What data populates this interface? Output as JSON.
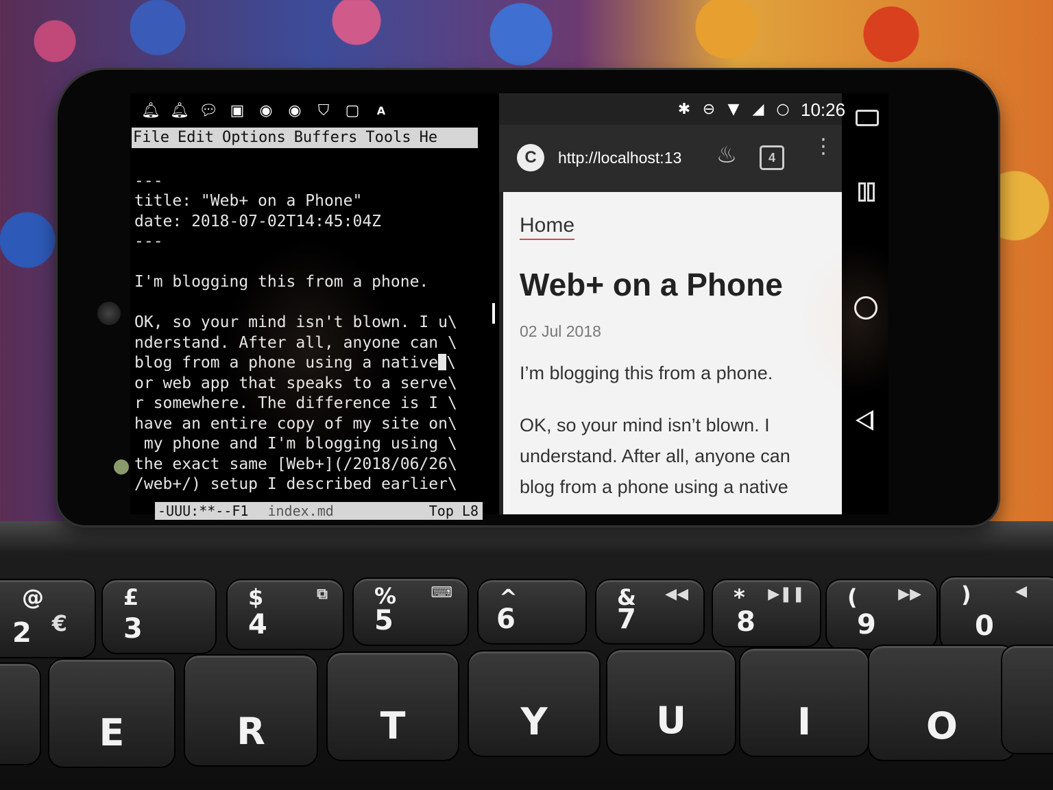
{
  "status_bar": {
    "left_icons": [
      "notification-3-icon",
      "bell-icon",
      "chat-bubble-icon",
      "image-icon",
      "record-icon",
      "record-icon-2",
      "shield-icon",
      "terminal-icon",
      "keyboard-a-icon"
    ],
    "right_icons": [
      "bluetooth-icon",
      "do-not-disturb-icon",
      "wifi-icon",
      "signal-icon",
      "loading-ring-icon"
    ],
    "time": "10:26"
  },
  "emacs": {
    "menu": [
      "File",
      "Edit",
      "Options",
      "Buffers",
      "Tools",
      "He"
    ],
    "lines": [
      "---",
      "title: \"Web+ on a Phone\"",
      "date: 2018-07-02T14:45:04Z",
      "---",
      "",
      "I'm blogging this from a phone.",
      "",
      "OK, so your mind isn't blown. I u\\",
      "nderstand. After all, anyone can \\",
      "blog from a phone using a native",
      "or web app that speaks to a serve\\",
      "r somewhere. The difference is I \\",
      "have an entire copy of my site on\\",
      " my phone and I'm blogging using \\",
      "the exact same [Web+](/2018/06/26\\",
      "/web+/) setup I described earlier\\"
    ],
    "cursor_line_suffix": "\\",
    "modeline": {
      "status": "-UUU:**--F1",
      "filename": "index.md",
      "position": "Top L8"
    }
  },
  "browser": {
    "site_letter": "C",
    "url": "http://localhost:13",
    "tab_count": "4",
    "page": {
      "nav_link": "Home",
      "title": "Web+ on a Phone",
      "date": "02 Jul 2018",
      "paragraph1": "I’m blogging this from a phone.",
      "paragraph2": "OK, so your mind isn’t blown. I understand. After all, anyone can blog from a phone using a native"
    }
  },
  "keyboard": {
    "top_row": [
      {
        "sym": "@",
        "main": "2",
        "extra": "€"
      },
      {
        "sym": "£",
        "main": "3",
        "extra": ""
      },
      {
        "sym": "$",
        "main": "4",
        "extra": ""
      },
      {
        "sym": "%",
        "main": "5",
        "extra": ""
      },
      {
        "sym": "^",
        "main": "6",
        "extra": ""
      },
      {
        "sym": "&",
        "main": "7",
        "extra": ""
      },
      {
        "sym": "*",
        "main": "8",
        "extra": ""
      },
      {
        "sym": "(",
        "main": "9",
        "extra": ""
      },
      {
        "sym": ")",
        "main": "0",
        "extra": ""
      }
    ],
    "letter_row": [
      "E",
      "R",
      "T",
      "Y",
      "U",
      "I",
      "O"
    ]
  }
}
